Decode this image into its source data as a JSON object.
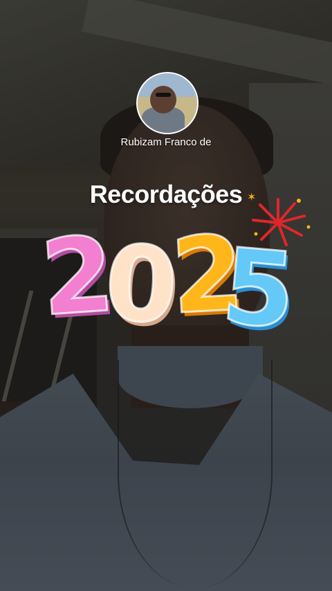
{
  "profile": {
    "username": "Rubizam Franco de",
    "avatar_icon": "profile-photo"
  },
  "story": {
    "title": "Recordações",
    "year_digits": [
      "2",
      "0",
      "2",
      "5"
    ],
    "sparkle_icon": "sparkle-icon",
    "firework_icon": "firework-icon"
  },
  "colors": {
    "digit_pink": "#f27fd0",
    "digit_cream": "#ffe3c9",
    "digit_orange": "#ffb61a",
    "digit_blue": "#64c9f7",
    "firework_red": "#e0262b",
    "sparkle_gold": "#f2b11c"
  }
}
